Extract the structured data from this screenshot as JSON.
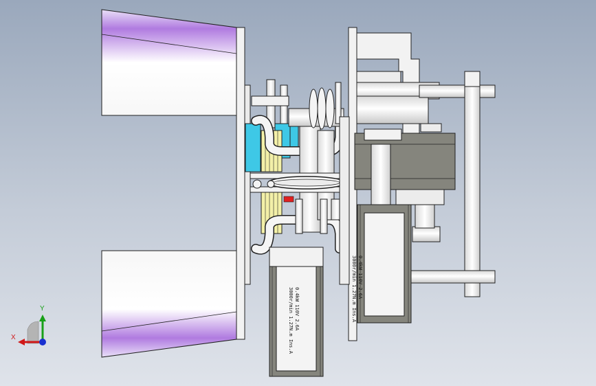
{
  "viewport": {
    "background_top": "#9aa8bc",
    "background_bottom": "#dfe3ea"
  },
  "motors": [
    {
      "line1": "0.4kW 110V 2.6A",
      "line2": "3000r/min 1.27N.m Ins.A"
    },
    {
      "line1": "0.4kW 110V 2.6A",
      "line2": "3000r/min 1.27N.m Ins.A"
    }
  ],
  "triad": {
    "x_label": "X",
    "y_label": "Y",
    "x_color": "#d01818",
    "y_color": "#18a018",
    "z_color": "#1830d0"
  },
  "colors": {
    "part_white": "#f2f2f2",
    "part_edge": "#202020",
    "motor_gray": "#85857d",
    "accent_cyan": "#3ec8e6",
    "accent_yellow": "#f3f0a8",
    "accent_red": "#e02020"
  }
}
